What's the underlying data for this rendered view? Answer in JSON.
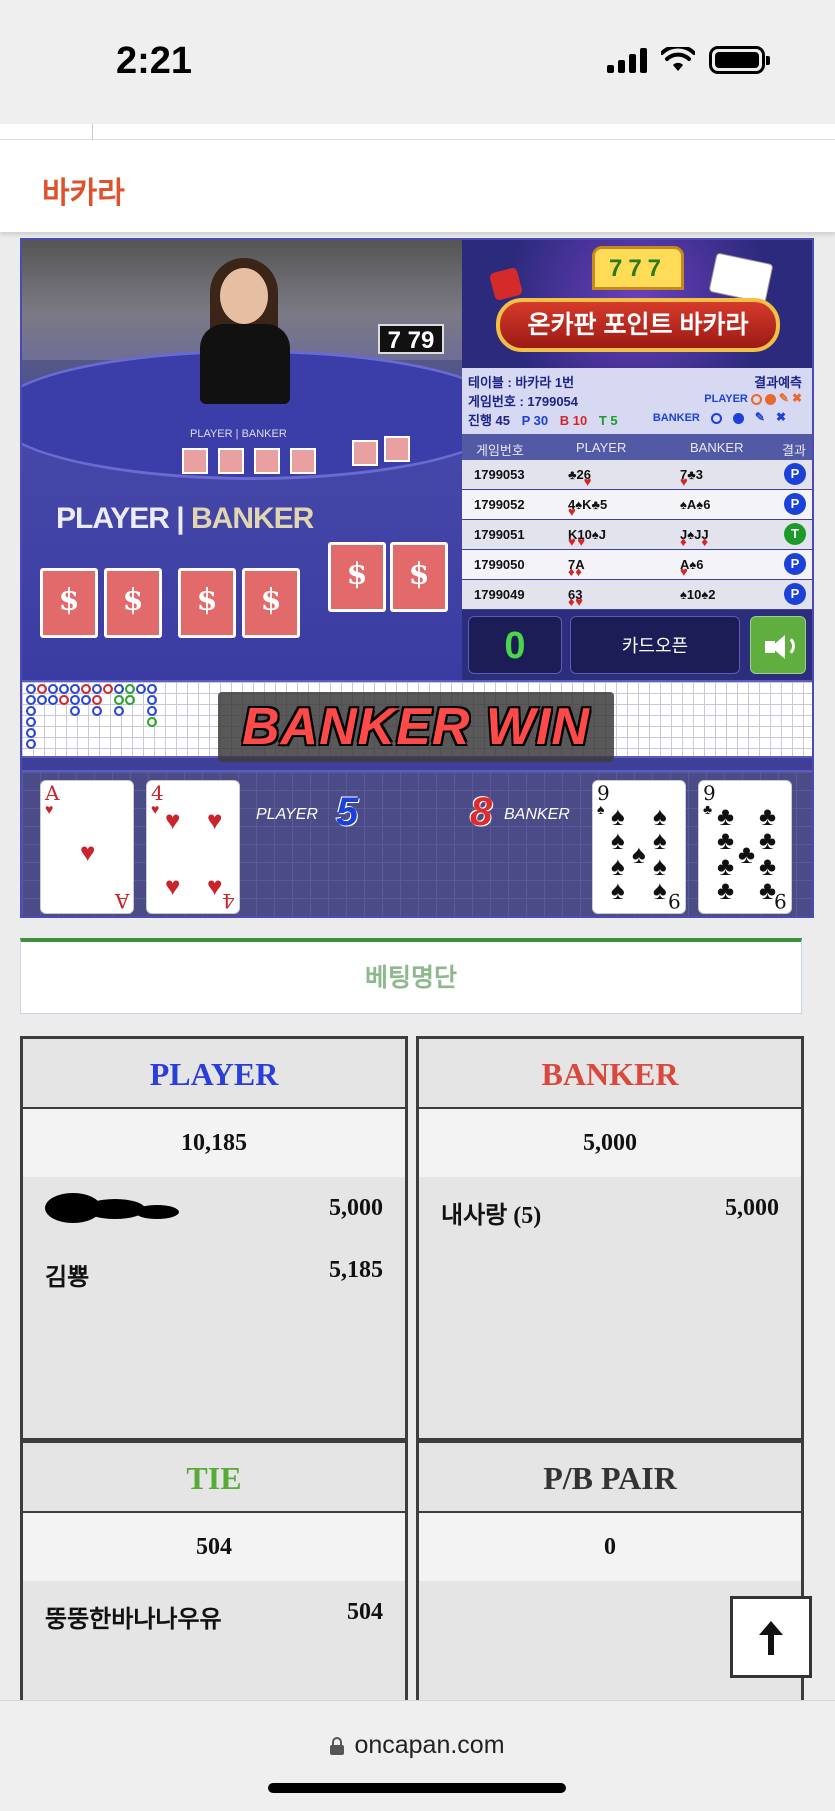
{
  "status_bar": {
    "time": "2:21"
  },
  "header": {
    "title": "바카라"
  },
  "game": {
    "shoe_counter": "7 79",
    "table_label_small": "PLAYER | BANKER",
    "pb_player": "PLAYER",
    "pb_banker": "BANKER",
    "banner": {
      "slot": "777",
      "title": "온카판 포인트 바카라"
    },
    "info": {
      "table": "테이블 : 바카라 1번",
      "game_no": "게임번호 : 1799054",
      "progress_label": "진행 45",
      "p_count": "P 30",
      "b_count": "B 10",
      "t_count": "T 5",
      "predict_label": "결과예측",
      "predict_player": "PLAYER",
      "predict_banker": "BANKER"
    },
    "history": {
      "headers": [
        "게임번호",
        "PLAYER",
        "BANKER",
        "결과"
      ],
      "rows": [
        {
          "no": "1799053",
          "player": "♣2♥6",
          "banker": "♥7♣3",
          "result": "P"
        },
        {
          "no": "1799052",
          "player": "♥4♠K♣5",
          "banker": "♠A♠6",
          "result": "P"
        },
        {
          "no": "1799051",
          "player": "♥K♥10♠J",
          "banker": "♦J♠J♦J",
          "result": "T"
        },
        {
          "no": "1799050",
          "player": "♦7♦A",
          "banker": "♥A♠6",
          "result": "P"
        },
        {
          "no": "1799049",
          "player": "♦6♥3",
          "banker": "♠10♠2",
          "result": "P"
        }
      ]
    },
    "count": "0",
    "open_button": "카드오픈",
    "win_banner": "BANKER WIN",
    "player_label": "PLAYER",
    "player_score": "5",
    "banker_label": "BANKER",
    "banker_score": "8",
    "cards": {
      "player": [
        {
          "rank": "A",
          "suit": "♥",
          "color": "red"
        },
        {
          "rank": "4",
          "suit": "♥",
          "color": "red"
        }
      ],
      "banker": [
        {
          "rank": "9",
          "suit": "♠",
          "color": "black"
        },
        {
          "rank": "9",
          "suit": "♣",
          "color": "black"
        }
      ]
    }
  },
  "betting": {
    "title": "베팅명단",
    "player": {
      "title": "PLAYER",
      "color": "#2a3fd8",
      "total": "10,185",
      "entries": [
        {
          "name": "",
          "amount": "5,000",
          "redacted": true
        },
        {
          "name": "김뿅",
          "amount": "5,185"
        }
      ]
    },
    "banker": {
      "title": "BANKER",
      "color": "#d9483a",
      "total": "5,000",
      "entries": [
        {
          "name": "내사랑 (5)",
          "amount": "5,000"
        }
      ]
    },
    "tie": {
      "title": "TIE",
      "color": "#5aaa3a",
      "total": "504",
      "entries": [
        {
          "name": "뚱뚱한바나나우유",
          "amount": "504"
        }
      ]
    },
    "pair": {
      "title": "P/B PAIR",
      "color": "#333333",
      "total": "0",
      "entries": []
    }
  },
  "browser": {
    "url": "oncapan.com"
  }
}
